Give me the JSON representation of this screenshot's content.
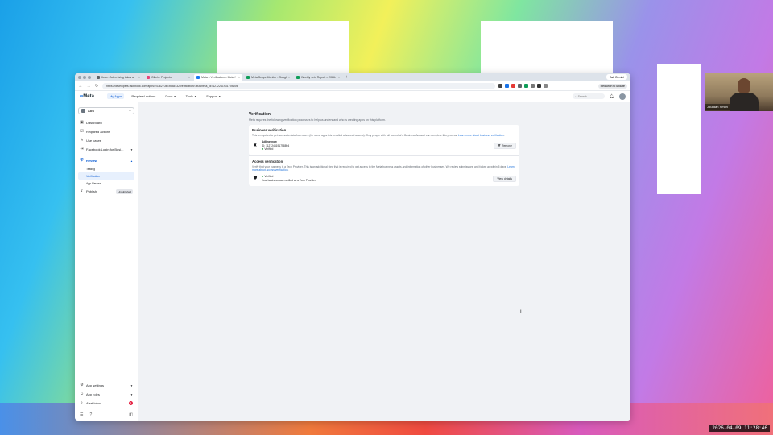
{
  "browser": {
    "tabs": [
      {
        "label": "Ilono - Advertising takes a",
        "color": "#5f6368"
      },
      {
        "label": "Glitch - Projects",
        "color": "#e8457a"
      },
      {
        "label": "Meta – Verification – Meta f",
        "color": "#1877f2",
        "active": true
      },
      {
        "label": "Meta Scope Monitor - Google",
        "color": "#0f9d58"
      },
      {
        "label": "Weekly sets Report – 2026-",
        "color": "#0f9d58"
      }
    ],
    "ask_gemini": "Ask Gemini",
    "url": "https://developers.facebook.com/apps/2476270478938432/verification/?business_id=1272241931794894",
    "relaunch": "Relaunch to update"
  },
  "header": {
    "logo": "Meta",
    "menu": [
      {
        "label": "My Apps",
        "selected": true,
        "caret": false
      },
      {
        "label": "Required actions",
        "selected": false,
        "caret": false
      },
      {
        "label": "Docs",
        "selected": false,
        "caret": true
      },
      {
        "label": "Tools",
        "selected": false,
        "caret": true
      },
      {
        "label": "Support",
        "selected": false,
        "caret": true
      }
    ],
    "search_placeholder": "Search..."
  },
  "sidebar": {
    "app_name": "ABU",
    "items": [
      {
        "label": "Dashboard",
        "icon": "dashboard-icon"
      },
      {
        "label": "Required actions",
        "icon": "checklist-icon"
      },
      {
        "label": "Use cases",
        "icon": "pencil-icon"
      },
      {
        "label": "Facebook Login for Busi...",
        "icon": "login-icon"
      }
    ],
    "review": {
      "label": "Review",
      "subitems": [
        {
          "label": "Testing",
          "active": false
        },
        {
          "label": "Verification",
          "active": true
        },
        {
          "label": "App Review",
          "active": false
        }
      ]
    },
    "publish": {
      "label": "Publish",
      "badge": "Unpublished"
    },
    "bottom": {
      "app_settings": "App settings",
      "app_roles": "App roles",
      "alert_inbox": "Alert Inbox",
      "alert_count": "1"
    }
  },
  "content": {
    "title": "Verification",
    "subtitle": "Meta requires the following verification processes to help us understand who is creating apps on this platform.",
    "business": {
      "title": "Business verification",
      "desc": "This is required to get access to data from users (for some apps this is called advanced access). Only people with full control of a Business Account can complete this process.",
      "link": "Learn more about business verification",
      "name": "Adlingynow",
      "id": "ID: 1127244191758894",
      "status": "Verified",
      "button": "Remove"
    },
    "access": {
      "title": "Access verification",
      "desc": "Verify that your business is a Tech Provider. This is an additional step that is required to get access to the Meta business assets and information of other businesses. We review submissions and follow up within 5 days.",
      "link": "Learn more about access verification",
      "status": "Verified",
      "note": "Your business was verified as a Tech Provider",
      "button": "View details"
    }
  },
  "webcam": {
    "name": "Jourdan Smith"
  },
  "timestamp": "2026-04-09 11:28:46"
}
